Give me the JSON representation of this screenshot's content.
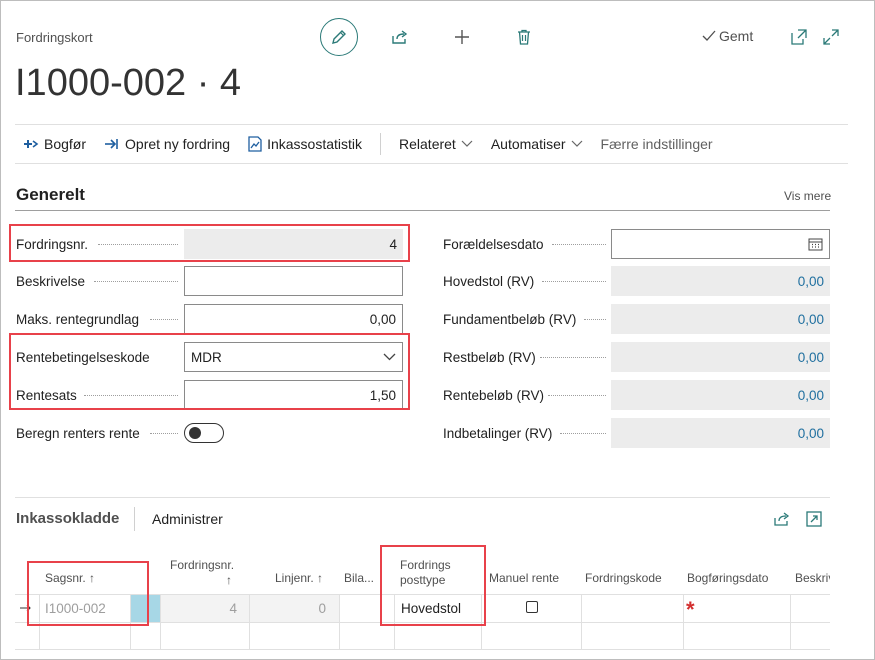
{
  "header": {
    "caption": "Fordringskort",
    "title": "I1000-002 · 4",
    "saved_label": "Gemt"
  },
  "toolbar": {
    "post": "Bogfør",
    "new_claim": "Opret ny fordring",
    "statistics": "Inkassostatistik",
    "related": "Relateret",
    "automate": "Automatiser",
    "fewer_options": "Færre indstillinger"
  },
  "general": {
    "title": "Generelt",
    "show_more": "Vis mere",
    "left_fields": {
      "claim_no": {
        "label": "Fordringsnr.",
        "value": "4"
      },
      "description": {
        "label": "Beskrivelse",
        "value": ""
      },
      "max_interest_base": {
        "label": "Maks. rentegrundlag",
        "value": "0,00"
      },
      "interest_terms_code": {
        "label": "Rentebetingelseskode",
        "value": "MDR"
      },
      "interest_rate": {
        "label": "Rentesats",
        "value": "1,50"
      },
      "compound_interest": {
        "label": "Beregn renters rente",
        "value": false
      }
    },
    "right_fields": {
      "limitation_date": {
        "label": "Forældelsesdato",
        "value": ""
      },
      "principal": {
        "label": "Hovedstol (RV)",
        "value": "0,00"
      },
      "fundament_amount": {
        "label": "Fundamentbeløb (RV)",
        "value": "0,00"
      },
      "remaining_amount": {
        "label": "Restbeløb (RV)",
        "value": "0,00"
      },
      "interest_amount": {
        "label": "Rentebeløb (RV)",
        "value": "0,00"
      },
      "payments": {
        "label": "Indbetalinger (RV)",
        "value": "0,00"
      }
    }
  },
  "journal": {
    "title": "Inkassokladde",
    "manage": "Administrer",
    "columns": {
      "case_no": "Sagsnr. ↑",
      "claim_no": "Fordringsnr.",
      "claim_no_arrow": "↑",
      "line_no": "Linjenr. ↑",
      "voucher": "Bila...",
      "entry_type_1": "Fordrings",
      "entry_type_2": "posttype",
      "manual_interest": "Manuel rente",
      "claim_code": "Fordringskode",
      "posting_date": "Bogføringsdato",
      "description": "Beskriv"
    },
    "row": {
      "case_no": "I1000-002",
      "claim_no": "4",
      "line_no": "0",
      "entry_type": "Hovedstol",
      "manual_interest": false,
      "required_marker": "*"
    }
  },
  "colors": {
    "accent": "#2b7a78",
    "highlight_box": "#e8414a",
    "rv_value": "#1f6f9f",
    "required": "#d32f2f"
  }
}
